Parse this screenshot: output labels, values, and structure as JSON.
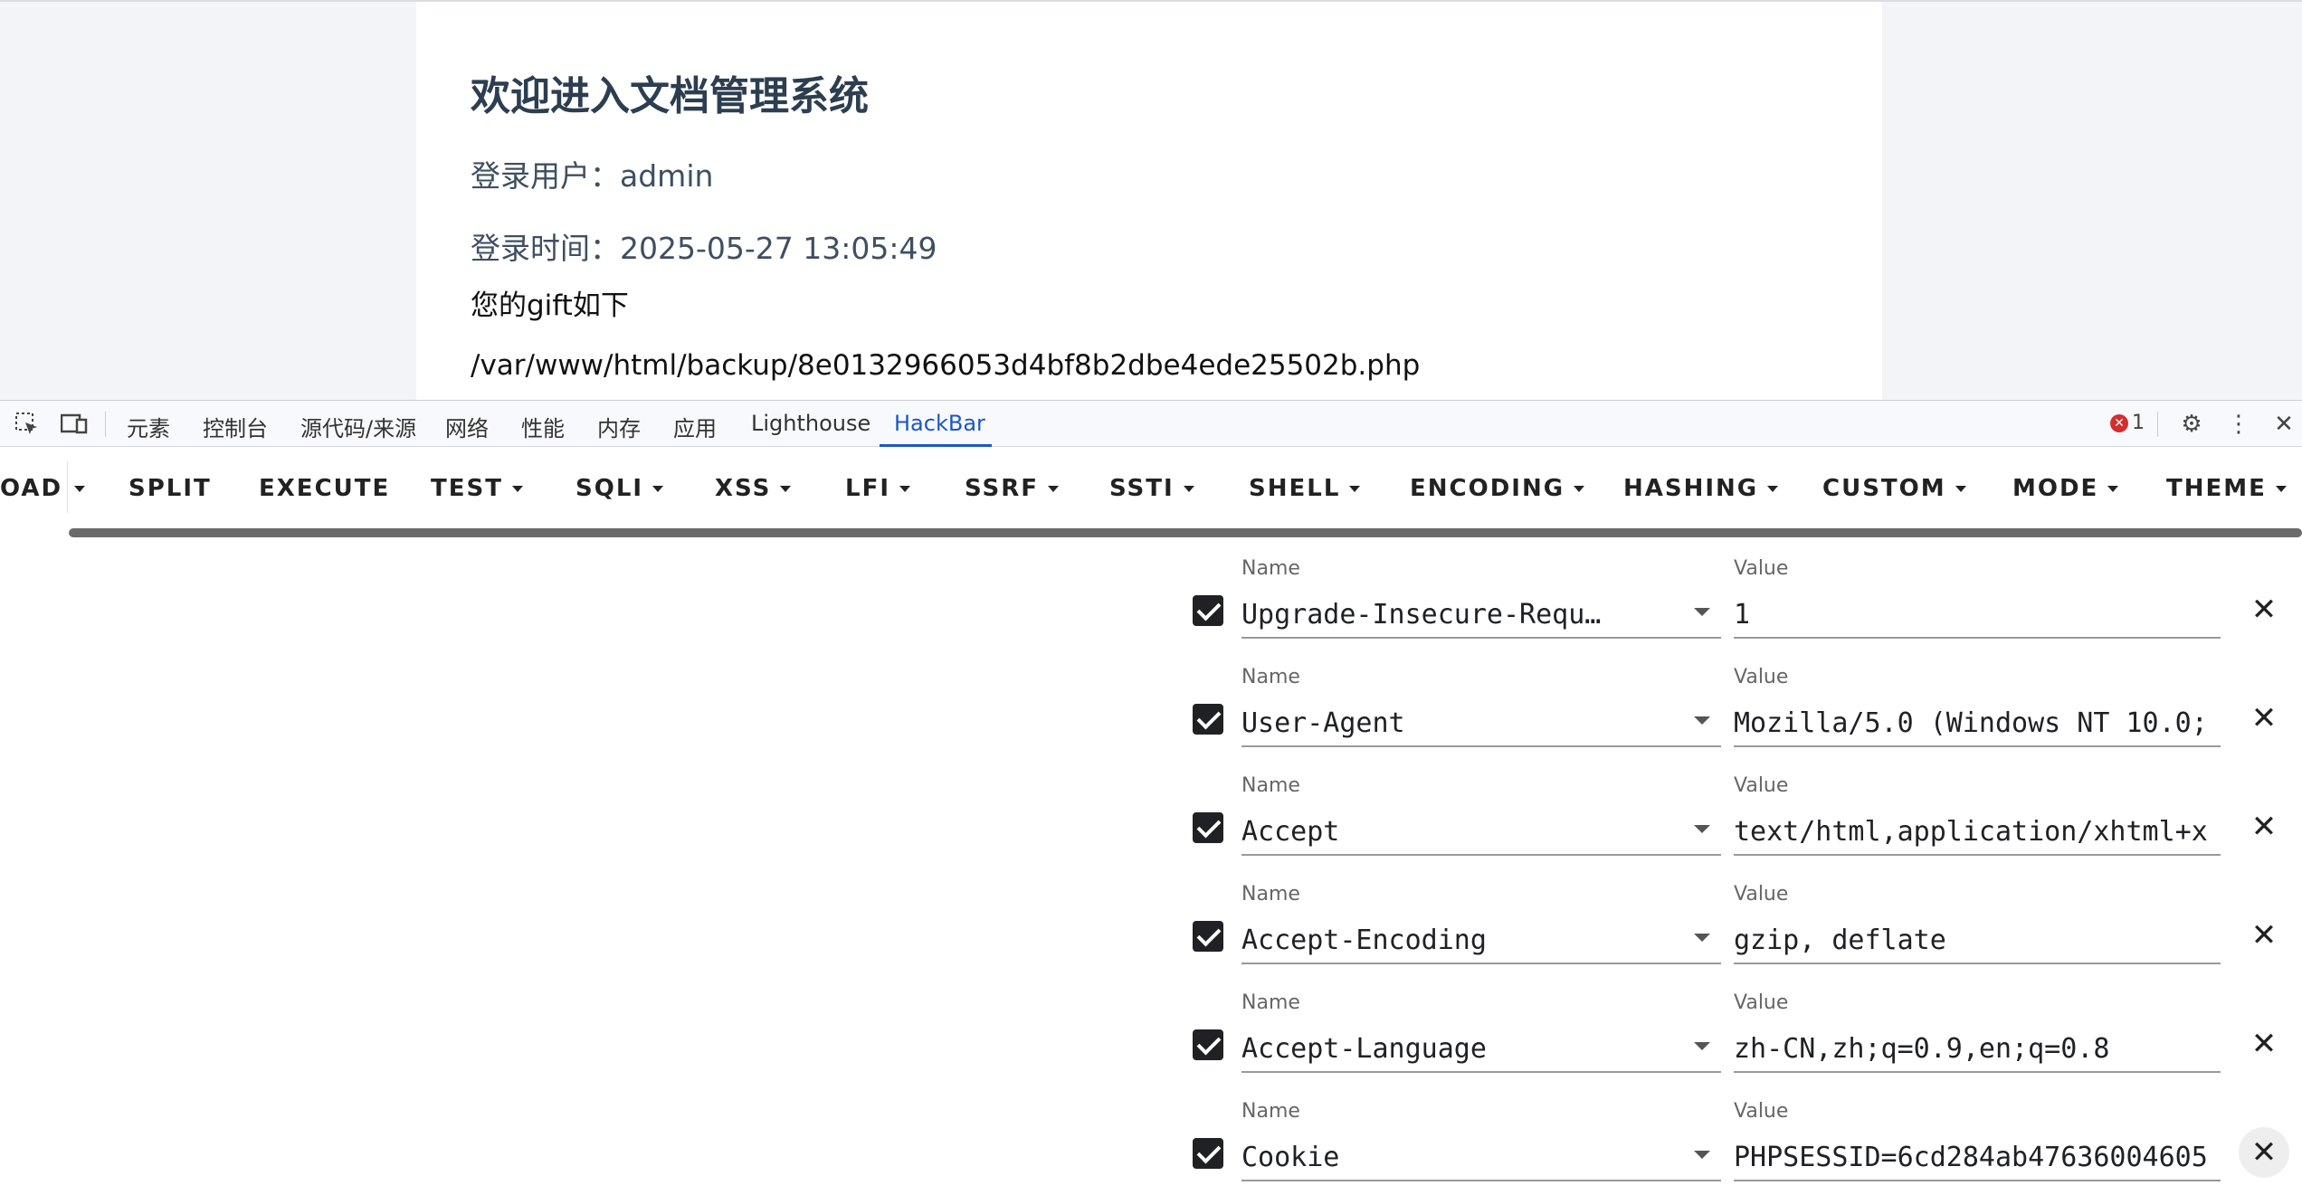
{
  "page": {
    "title": "欢迎进入文档管理系统",
    "user_line": "登录用户：admin",
    "time_line": "登录时间：2025-05-27 13:05:49",
    "gift_line": "您的gift如下",
    "path_line": "/var/www/html/backup/8e0132966053d4bf8b2dbe4ede25502b.php"
  },
  "devtools": {
    "icons": [
      "inspect-element-icon",
      "device-toggle-icon"
    ],
    "tabs": [
      "元素",
      "控制台",
      "源代码/来源",
      "网络",
      "性能",
      "内存",
      "应用",
      "Lighthouse",
      "HackBar"
    ],
    "active_tab": "HackBar",
    "error_count": "1"
  },
  "hackbar": {
    "load_label": "OAD",
    "buttons": [
      "SPLIT",
      "EXECUTE",
      "TEST",
      "SQLI",
      "XSS",
      "LFI",
      "SSRF",
      "SSTI",
      "SHELL",
      "ENCODING",
      "HASHING",
      "CUSTOM",
      "MODE",
      "THEME"
    ],
    "headers": [
      {
        "name_label": "Name",
        "name": "Upgrade-Insecure-Requ…",
        "value_label": "Value",
        "value": "1"
      },
      {
        "name_label": "Name",
        "name": "User-Agent",
        "value_label": "Value",
        "value": "Mozilla/5.0 (Windows NT 10.0;"
      },
      {
        "name_label": "Name",
        "name": "Accept",
        "value_label": "Value",
        "value": "text/html,application/xhtml+x"
      },
      {
        "name_label": "Name",
        "name": "Accept-Encoding",
        "value_label": "Value",
        "value": "gzip, deflate"
      },
      {
        "name_label": "Name",
        "name": "Accept-Language",
        "value_label": "Value",
        "value": "zh-CN,zh;q=0.9,en;q=0.8"
      },
      {
        "name_label": "Name",
        "name": "Cookie",
        "value_label": "Value",
        "value": "PHPSESSID=6cd284ab47636004605"
      }
    ]
  }
}
